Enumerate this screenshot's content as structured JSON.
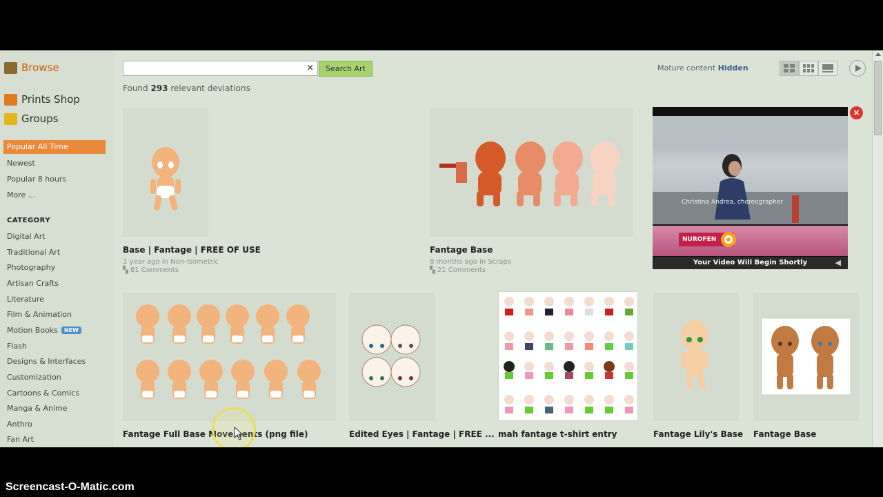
{
  "sidebar": {
    "browse": "Browse",
    "prints_shop": "Prints Shop",
    "groups": "Groups",
    "sort": [
      "Popular All Time",
      "Newest",
      "Popular 8 hours",
      "More ..."
    ],
    "category_heading": "CATEGORY",
    "categories": [
      "Digital Art",
      "Traditional Art",
      "Photography",
      "Artisan Crafts",
      "Literature",
      "Film & Animation",
      "Motion Books",
      "Flash",
      "Designs & Interfaces",
      "Customization",
      "Cartoons & Comics",
      "Manga & Anime",
      "Anthro",
      "Fan Art"
    ],
    "new_badge": "NEW"
  },
  "search": {
    "value": "",
    "clear": "×",
    "button": "Search Art"
  },
  "results": {
    "prefix": "Found ",
    "count": "293",
    "suffix": " relevant deviations"
  },
  "mature": {
    "label": "Mature content ",
    "value": "Hidden"
  },
  "deviations": [
    {
      "title": "Base | Fantage | FREE OF USE",
      "time": "1 year ago in Non-Isometric",
      "comments": "81 Comments"
    },
    {
      "title": "Fantage Base",
      "time": "8 months ago in Scraps",
      "comments": "21 Comments"
    },
    {
      "title": "Fantage Full Base Movements (png file)"
    },
    {
      "title": "Edited Eyes | Fantage | FREE ..."
    },
    {
      "title": "mah fantage t-shirt entry"
    },
    {
      "title": "Fantage Lily's Base"
    },
    {
      "title": "Fantage Base"
    }
  ],
  "ad": {
    "caption": "Christina Andrea, choreographer",
    "brand": "NUROFEN",
    "bar": "Your Video Will Begin Shortly",
    "close": "×"
  },
  "watermark": "Screencast-O-Matic.com",
  "colors": {
    "accent": "#e88a3a",
    "page_bg": "#dbe3d7",
    "search_button": "#a7d36f",
    "skin": "#f2b37c"
  }
}
